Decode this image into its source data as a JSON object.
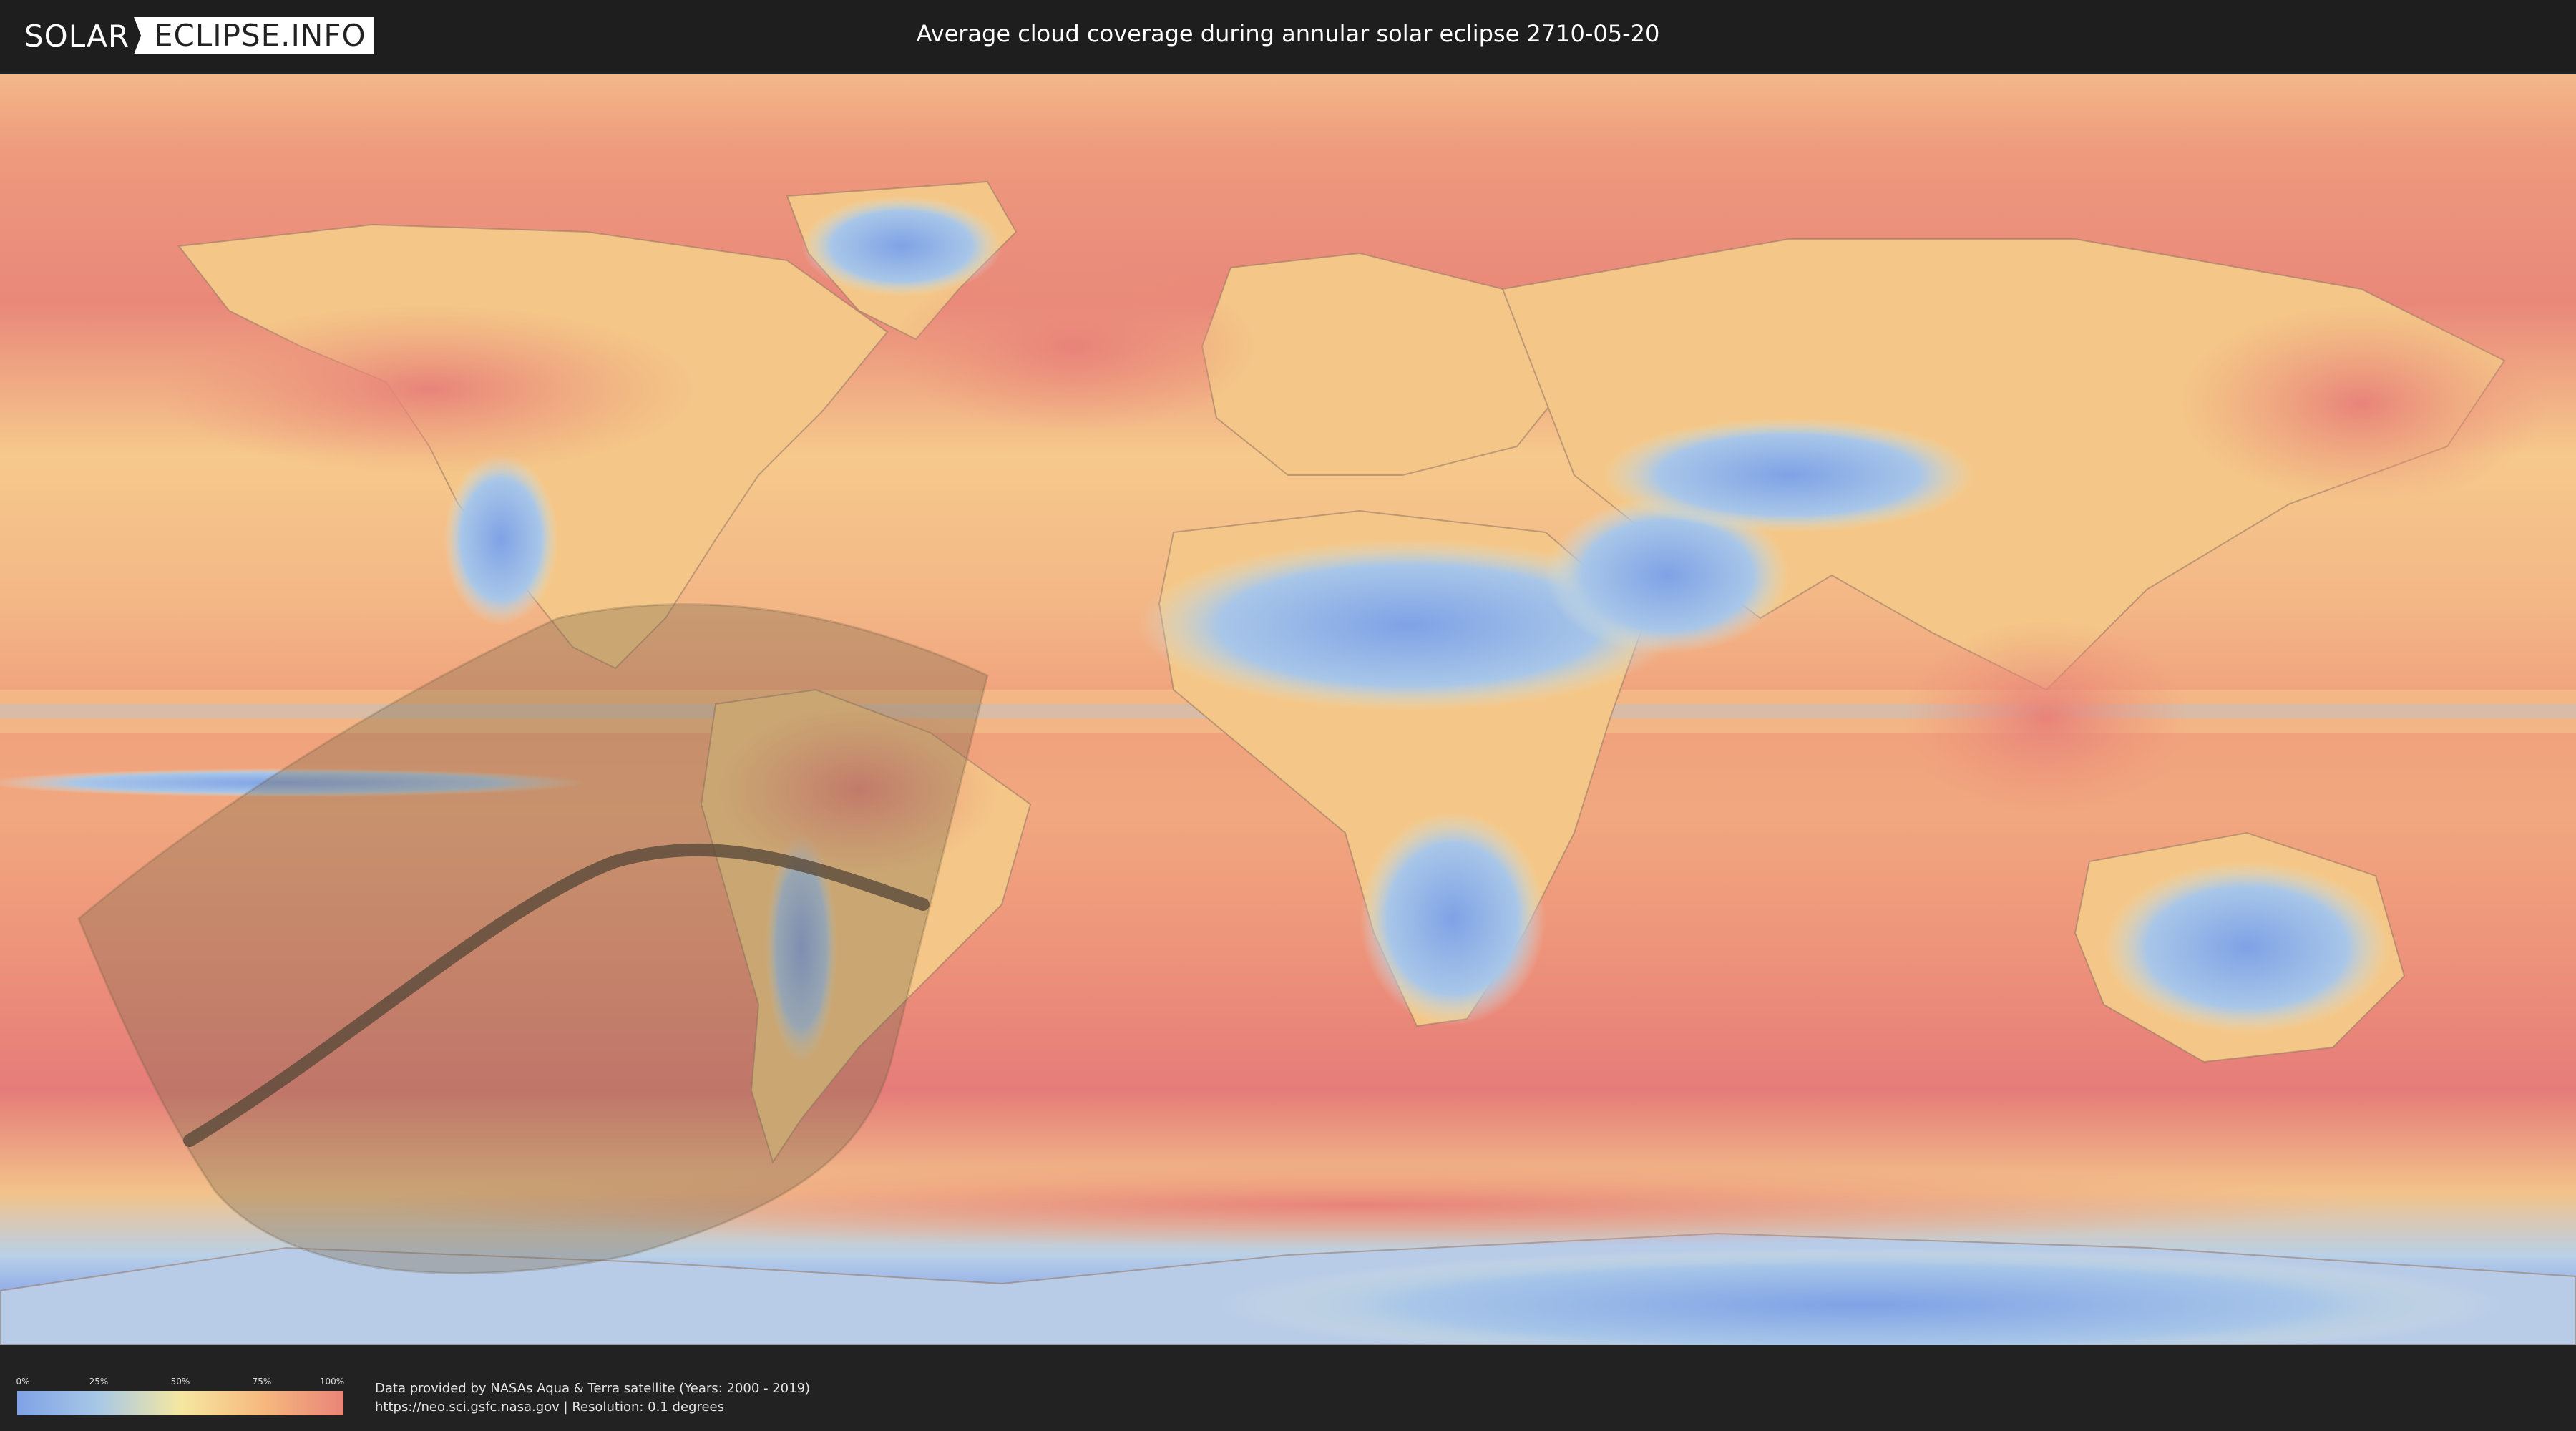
{
  "header": {
    "logo_part1": "SOLAR",
    "logo_part2": "ECLIPSE.INFO",
    "title": "Average cloud coverage during annular solar eclipse 2710-05-20"
  },
  "legend": {
    "ticks": [
      "0%",
      "25%",
      "50%",
      "75%",
      "100%"
    ],
    "colors": [
      "#7fa2e6",
      "#a8c8e6",
      "#f5e7a1",
      "#f6b97e",
      "#e98478"
    ]
  },
  "credits": {
    "line1": "Data provided by NASAs Aqua & Terra satellite (Years: 2000 - 2019)",
    "line2": "https://neo.sci.gsfc.nasa.gov | Resolution: 0.1 degrees"
  },
  "map": {
    "ocean_color": "#f1a07c",
    "cloudy_band_color": "#e9867a",
    "land_clear_color": "#8fb2e8",
    "eclipse_shadow_color": "#7a6a4e",
    "central_line_color": "#5a4a3a"
  }
}
